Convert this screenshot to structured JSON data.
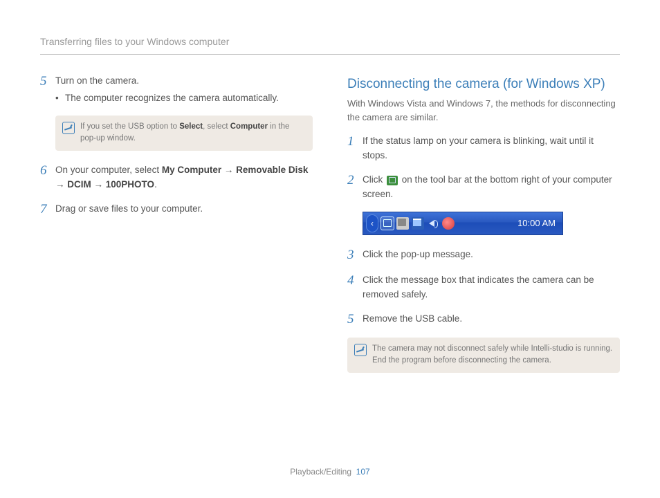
{
  "header": {
    "title": "Transferring files to your Windows computer"
  },
  "left": {
    "step5": {
      "num": "5",
      "title": "Turn on the camera.",
      "bullet": "The computer recognizes the camera automatically."
    },
    "note1": {
      "pre": "If you set the USB option to ",
      "b1": "Select",
      "mid": ", select ",
      "b2": "Computer",
      "post": " in the pop-up window."
    },
    "step6": {
      "num": "6",
      "pre": "On your computer, select ",
      "b1": "My Computer",
      "arrow1": " → ",
      "b2": "Removable Disk",
      "arrow2": " → ",
      "b3": "DCIM",
      "arrow3": " → ",
      "b4": "100PHOTO",
      "post": "."
    },
    "step7": {
      "num": "7",
      "text": "Drag or save files to your computer."
    }
  },
  "right": {
    "title": "Disconnecting the camera (for Windows XP)",
    "subtitle": "With Windows Vista and Windows 7, the methods for disconnecting the camera are similar.",
    "step1": {
      "num": "1",
      "text": "If the status lamp on your camera is blinking, wait until it stops."
    },
    "step2": {
      "num": "2",
      "pre": "Click ",
      "post": " on the tool bar at the bottom right of your computer screen."
    },
    "taskbar_clock": "10:00 AM",
    "step3": {
      "num": "3",
      "text": "Click the pop-up message."
    },
    "step4": {
      "num": "4",
      "text": "Click the message box that indicates the camera can be removed safely."
    },
    "step5": {
      "num": "5",
      "text": "Remove the USB cable."
    },
    "note2": "The camera may not disconnect safely while Intelli-studio is running. End the program before disconnecting the camera."
  },
  "footer": {
    "section": "Playback/Editing",
    "page": "107"
  }
}
